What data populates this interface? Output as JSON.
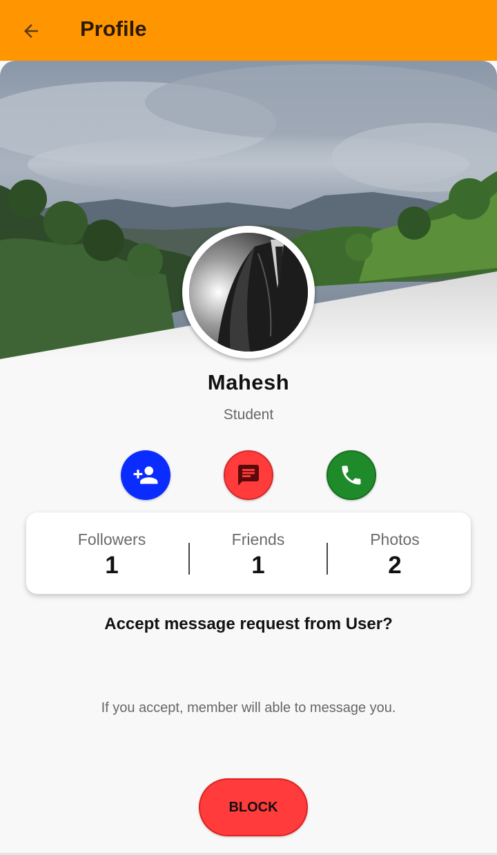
{
  "app_bar": {
    "title": "Profile",
    "back_icon": "arrow-left-icon",
    "color": "#ff9500"
  },
  "profile": {
    "name": "Mahesh",
    "role": "Student"
  },
  "actions": [
    {
      "name": "add-friend",
      "icon": "person-add-icon",
      "color": "#0a2cff"
    },
    {
      "name": "message",
      "icon": "message-icon",
      "color": "#ff3b3b"
    },
    {
      "name": "call",
      "icon": "phone-icon",
      "color": "#1f8a2a"
    }
  ],
  "stats": {
    "followers": {
      "label": "Followers",
      "value": "1"
    },
    "friends": {
      "label": "Friends",
      "value": "1"
    },
    "photos": {
      "label": "Photos",
      "value": "2"
    }
  },
  "request": {
    "question": "Accept message request from User?",
    "info": "If you accept, member will able to message you."
  },
  "block_button": {
    "label": "BLOCK",
    "color": "#ff3b3b"
  }
}
